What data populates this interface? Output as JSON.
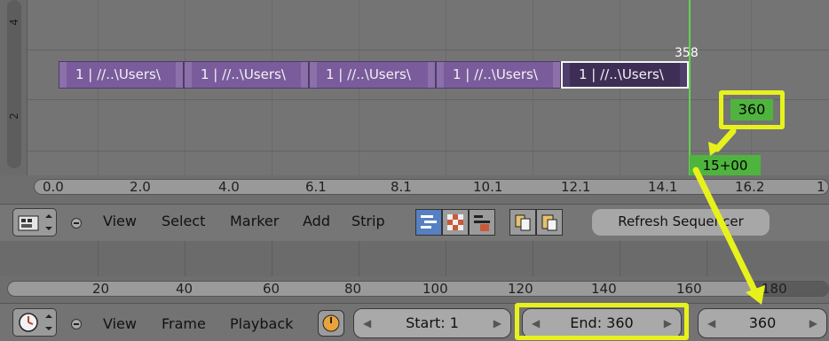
{
  "sequencer": {
    "y_labels": [
      "4",
      "2"
    ],
    "strips": [
      {
        "label": "1 | //..\\Users\\",
        "selected": false
      },
      {
        "label": "1 | //..\\Users\\",
        "selected": false
      },
      {
        "label": "1 | //..\\Users\\",
        "selected": false
      },
      {
        "label": "1 | //..\\Users\\",
        "selected": false
      },
      {
        "label": "1 | //..\\Users\\",
        "selected": true
      }
    ],
    "current_frame_label": "358",
    "frame_callout": "360",
    "time_callout": "15+00",
    "time_ticks": [
      "0.0",
      "2.0",
      "4.0",
      "6.1",
      "8.1",
      "10.1",
      "12.1",
      "14.1",
      "16.2",
      "1"
    ]
  },
  "header": {
    "menus": [
      "View",
      "Select",
      "Marker",
      "Add",
      "Strip"
    ],
    "refresh_label": "Refresh Sequencer"
  },
  "timeline": {
    "frame_ticks": [
      "20",
      "40",
      "60",
      "80",
      "100",
      "120",
      "140",
      "160",
      "180"
    ]
  },
  "footer": {
    "menus": [
      "View",
      "Frame",
      "Playback"
    ],
    "start_label": "Start: 1",
    "end_label": "End: 360",
    "current_label": "360"
  },
  "colors": {
    "strip": "#7a5c9c",
    "strip_selected": "#3e2e56",
    "playhead": "#63d34c",
    "annotation": "#e7f21c"
  }
}
